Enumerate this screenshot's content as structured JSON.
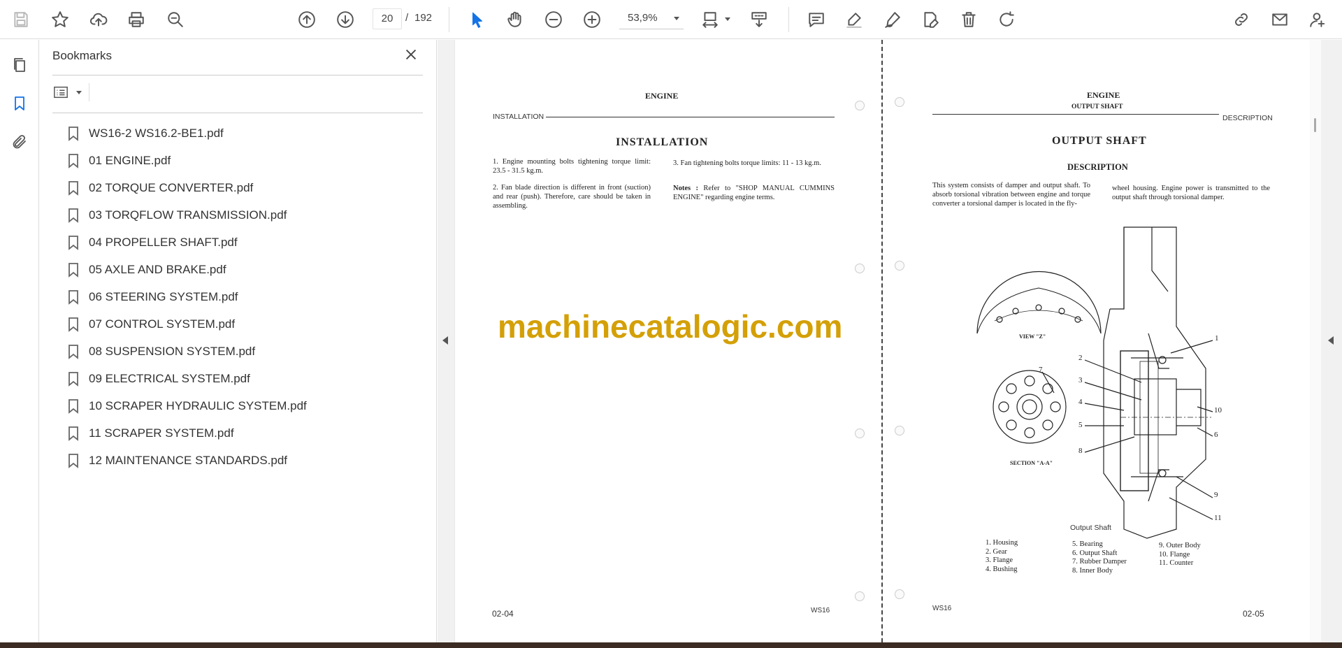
{
  "toolbar": {
    "page_current": "20",
    "page_separator": "/",
    "page_total": "192",
    "zoom": "53,9%"
  },
  "bookmarks": {
    "title": "Bookmarks",
    "items": [
      {
        "label": "WS16-2 WS16.2-BE1.pdf"
      },
      {
        "label": "01 ENGINE.pdf"
      },
      {
        "label": "02 TORQUE CONVERTER.pdf"
      },
      {
        "label": "03 TORQFLOW TRANSMISSION.pdf"
      },
      {
        "label": "04 PROPELLER SHAFT.pdf"
      },
      {
        "label": "05 AXLE AND BRAKE.pdf"
      },
      {
        "label": "06 STEERING SYSTEM.pdf"
      },
      {
        "label": "07 CONTROL SYSTEM.pdf"
      },
      {
        "label": "08 SUSPENSION SYSTEM.pdf"
      },
      {
        "label": "09 ELECTRICAL SYSTEM.pdf"
      },
      {
        "label": "10 SCRAPER HYDRAULIC SYSTEM.pdf"
      },
      {
        "label": "11 SCRAPER SYSTEM.pdf"
      },
      {
        "label": "12 MAINTENANCE STANDARDS.pdf"
      }
    ]
  },
  "left_page": {
    "header": "ENGINE",
    "section": "INSTALLATION",
    "title": "INSTALLATION",
    "item1": "1.  Engine mounting bolts tightening torque limit:  23.5 - 31.5 kg.m.",
    "item2": "2.  Fan blade direction is different in front (suction) and rear (push). Therefore, care should be taken in assembling.",
    "item3": "3.  Fan tightening bolts torque limits: 11 - 13 kg.m.",
    "notes_label": "Notes :",
    "notes_text": "Refer to \"SHOP MANUAL CUMMINS ENGINE\" regarding engine terms.",
    "page_no": "02-04",
    "model": "WS16"
  },
  "right_page": {
    "header": "ENGINE",
    "subheader": "OUTPUT SHAFT",
    "section": "DESCRIPTION",
    "title": "OUTPUT SHAFT",
    "subtitle": "DESCRIPTION",
    "desc_col1": "This system consists of damper and output shaft.  To absorb torsional vibration between engine and torque converter a torsional damper is located in the fly-",
    "desc_col2": "wheel housing.  Engine power is transmitted to the output shaft through torsional damper.",
    "view_label": "VIEW \"Z\"",
    "section_label": "SECTION \"A-A\"",
    "figure_caption": "Output Shaft",
    "callouts": [
      "1",
      "2",
      "3",
      "4",
      "5",
      "6",
      "7",
      "8",
      "9",
      "10",
      "11"
    ],
    "legend_col1": "1. Housing\n2. Gear\n3. Flange\n4. Bushing",
    "legend_col2": "5. Bearing\n6. Output Shaft\n7. Rubber Damper\n8. Inner Body",
    "legend_col3": "9. Outer Body\n10. Flange\n11. Counter",
    "model": "WS16",
    "page_no": "02-05"
  },
  "watermark": "machinecatalogic.com"
}
